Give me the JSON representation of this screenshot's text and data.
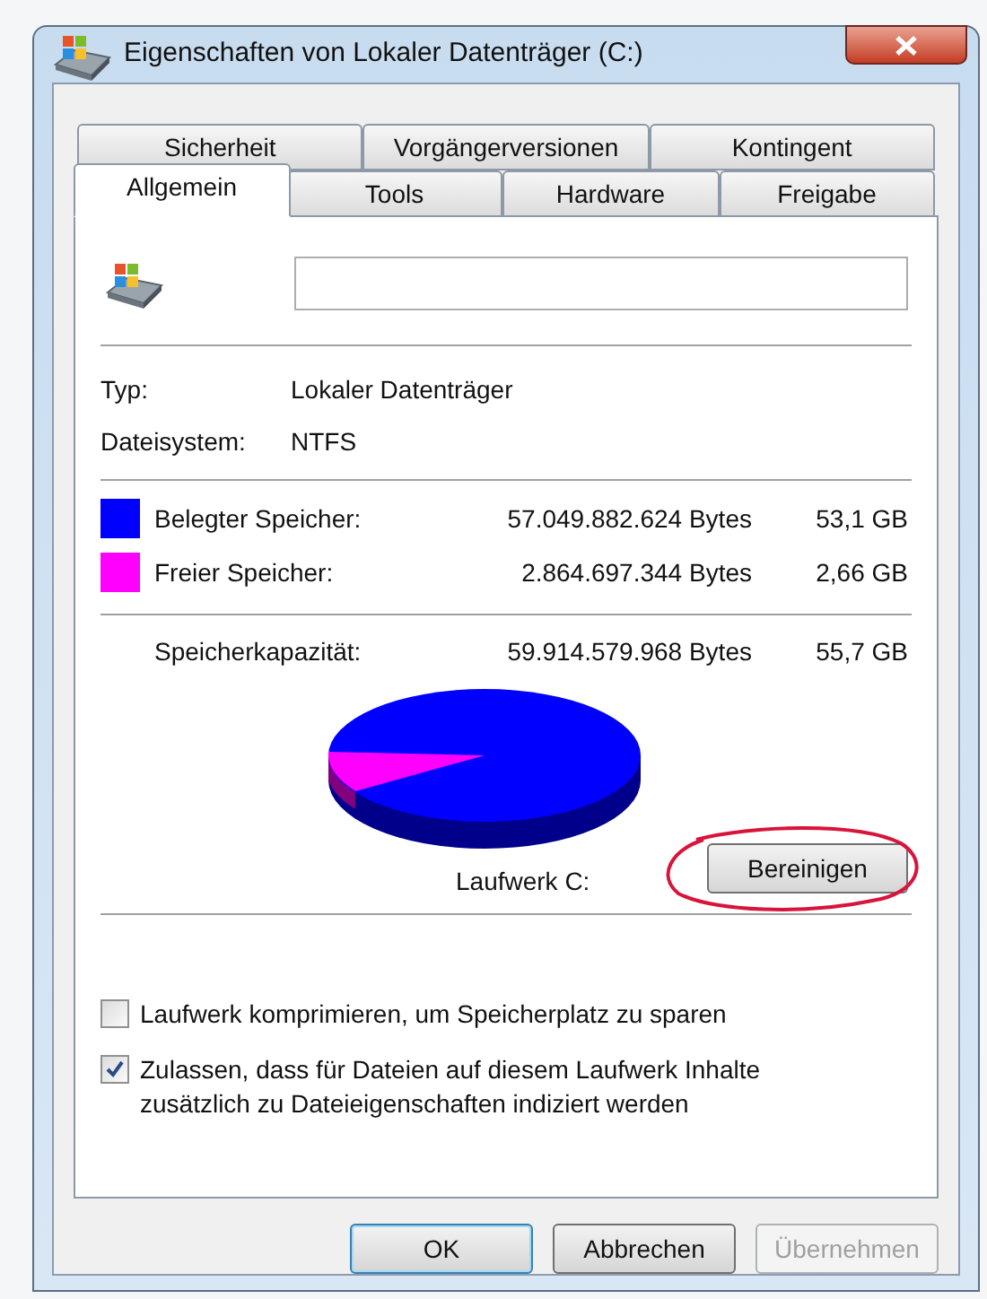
{
  "window": {
    "title": "Eigenschaften von Lokaler Datenträger (C:)"
  },
  "tab_rows": [
    [
      {
        "label": "Sicherheit",
        "selected": false
      },
      {
        "label": "Vorgängerversionen",
        "selected": false
      },
      {
        "label": "Kontingent",
        "selected": false
      }
    ],
    [
      {
        "label": "Allgemein",
        "selected": true
      },
      {
        "label": "Tools",
        "selected": false
      },
      {
        "label": "Hardware",
        "selected": false
      },
      {
        "label": "Freigabe",
        "selected": false
      }
    ]
  ],
  "info": [
    {
      "label": "Typ:",
      "value": "Lokaler Datenträger"
    },
    {
      "label": "Dateisystem:",
      "value": "NTFS"
    }
  ],
  "usage": [
    {
      "label": "Belegter Speicher:",
      "color": "#0000ff",
      "bytes": "57.049.882.624 Bytes",
      "size": "53,1 GB"
    },
    {
      "label": "Freier Speicher:",
      "color": "#ff00ff",
      "bytes": "2.864.697.344 Bytes",
      "size": "2,66 GB"
    }
  ],
  "capacity": {
    "label": "Speicherkapazität:",
    "bytes": "59.914.579.968 Bytes",
    "size": "55,7 GB"
  },
  "drive_label": "Laufwerk C:",
  "cleanup_button": "Bereinigen",
  "options": [
    {
      "label": "Laufwerk komprimieren, um Speicherplatz zu sparen",
      "checked": false
    },
    {
      "label": "Zulassen, dass für Dateien auf diesem Laufwerk Inhalte zusätzlich zu Dateieigenschaften indiziert werden",
      "checked": true
    }
  ],
  "buttons": [
    {
      "label": "OK",
      "kind": "default",
      "disabled": false
    },
    {
      "label": "Abbrechen",
      "kind": "normal",
      "disabled": false
    },
    {
      "label": "Übernehmen",
      "kind": "normal",
      "disabled": true
    }
  ]
}
